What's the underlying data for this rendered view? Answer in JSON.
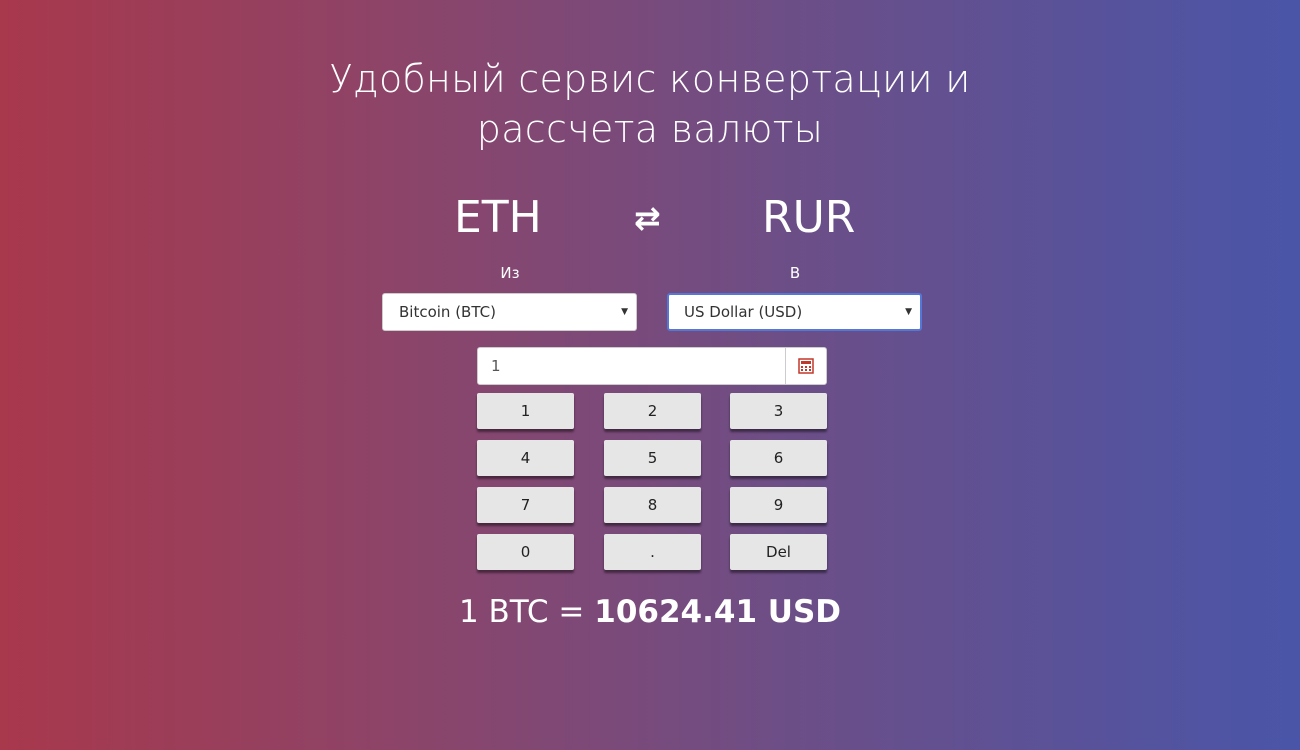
{
  "heading": {
    "line1": "Удобный сервис конвертации и",
    "line2": "рассчета валюты"
  },
  "pair": {
    "from": "ETH",
    "swap_icon": "⇄",
    "to": "RUR"
  },
  "converter": {
    "from_label": "Из",
    "to_label": "В",
    "from_selected": "Bitcoin (BTC)",
    "to_selected": "US Dollar (USD)",
    "amount_value": "1",
    "calculator_icon": "calculator-icon"
  },
  "keypad": {
    "keys": [
      "1",
      "2",
      "3",
      "4",
      "5",
      "6",
      "7",
      "8",
      "9",
      "0",
      ".",
      "Del"
    ]
  },
  "result": {
    "prefix": "1 BTC = ",
    "value": "10624.41 USD"
  },
  "colors": {
    "gradient_left": "#a8384c",
    "gradient_right": "#4a55a8",
    "focus_border": "#5577d8",
    "calculator_icon": "#c0392b"
  }
}
